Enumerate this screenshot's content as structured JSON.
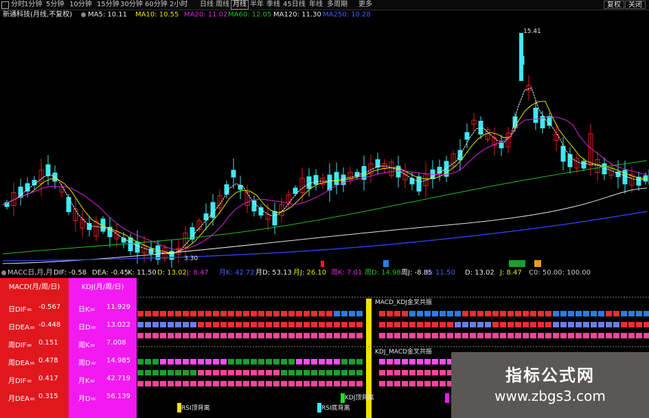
{
  "toolbar": {
    "periods": [
      "分时",
      "1分钟",
      "5分钟",
      "10分钟",
      "15分钟",
      "30分钟",
      "60分钟",
      "2小时",
      "日线",
      "周线",
      "月线",
      "半年",
      "季线",
      "45日线",
      "年线",
      "多周期",
      "更多"
    ],
    "active": "月线",
    "right_buttons": [
      "复权",
      "关闭"
    ]
  },
  "ma_line": {
    "title": "新通科技(月线,不复权)",
    "items": [
      {
        "label": "MA5: 10.11",
        "color": "#e8e8e8"
      },
      {
        "label": "MA10: 10.55",
        "color": "#e8e800"
      },
      {
        "label": "MA20: 11.02",
        "color": "#e020e0"
      },
      {
        "label": "MA60: 12.05",
        "color": "#20c020"
      },
      {
        "label": "MA120: 11.30",
        "color": "#e8e8e8"
      },
      {
        "label": "MA250: 10.28",
        "color": "#4060ff"
      }
    ]
  },
  "price_marks": {
    "high": "15.41",
    "low": "3.30"
  },
  "indicator_line": {
    "items": [
      {
        "label": "MACC日,月,月",
        "color": "#c8c8c8"
      },
      {
        "label": "DIF: -0.58",
        "color": "#e8e8e8"
      },
      {
        "label": "DEA: -0.45",
        "color": "#e8e8e8"
      },
      {
        "label": "K: 11.50",
        "color": "#e8e8e8"
      },
      {
        "label": "D: 13.02",
        "color": "#e8e800"
      },
      {
        "label": "J: 8.47",
        "color": "#e020e0"
      },
      {
        "label": "月K: 42.72",
        "color": "#4060ff"
      },
      {
        "label": "月D: 53.13",
        "color": "#e8e8e8"
      },
      {
        "label": "月J: 26.10",
        "color": "#e8e800"
      },
      {
        "label": "周K: 7.01",
        "color": "#e020e0"
      },
      {
        "label": "周D: 14.98",
        "color": "#20c020"
      },
      {
        "label": "周J: -8.85",
        "color": "#e8e8e8"
      },
      {
        "label": "K: 11.50",
        "color": "#4060ff"
      },
      {
        "label": "D: 13.02",
        "color": "#e8e8e8"
      },
      {
        "label": "J: 8.47",
        "color": "#e8e800"
      },
      {
        "label": "C0: 50.00: 100.00",
        "color": "#c8c8c8"
      }
    ]
  },
  "chart_tags": [
    "R",
    "B",
    "操盘",
    "顶"
  ],
  "macd_panel": {
    "header": "MACD(月/周/日)",
    "rows": [
      {
        "label": "日DIF=",
        "value": "-0.567"
      },
      {
        "label": "日DEA=",
        "value": "-0.448"
      },
      {
        "label": "周DIF=",
        "value": "0.151"
      },
      {
        "label": "周DEA=",
        "value": "0.478"
      },
      {
        "label": "月DIF=",
        "value": "0.417"
      },
      {
        "label": "月DEA=",
        "value": "0.315"
      }
    ]
  },
  "kdj_panel": {
    "header": "KDJ(月/周/日)",
    "rows": [
      {
        "label": "日K=",
        "value": "11.929"
      },
      {
        "label": "日D=",
        "value": "13.022"
      },
      {
        "label": "周K=",
        "value": "7.008"
      },
      {
        "label": "周D=",
        "value": "14.985"
      },
      {
        "label": "月K=",
        "value": "42.719"
      },
      {
        "label": "月D=",
        "value": "56.139"
      }
    ]
  },
  "signals": {
    "macd_kdj": "MACD_KDJ金叉共振",
    "kdj_macd": "KDJ_MACD金叉共振",
    "rsi_top": "RSI顶背离",
    "kdj_top": "KDJ顶背离",
    "rsi_bottom": "RSI底背离"
  },
  "watermark": {
    "line1": "指标公式网",
    "line2": "www.zbgs3.com"
  },
  "colors": {
    "up": "#e0201e",
    "down": "#40e8f0",
    "grid_red": "#e83030",
    "grid_blue": "#2a7ee8",
    "grid_pink": "#f0489a",
    "grid_green": "#18a030",
    "grid_pink2": "#ff4cf0"
  }
}
